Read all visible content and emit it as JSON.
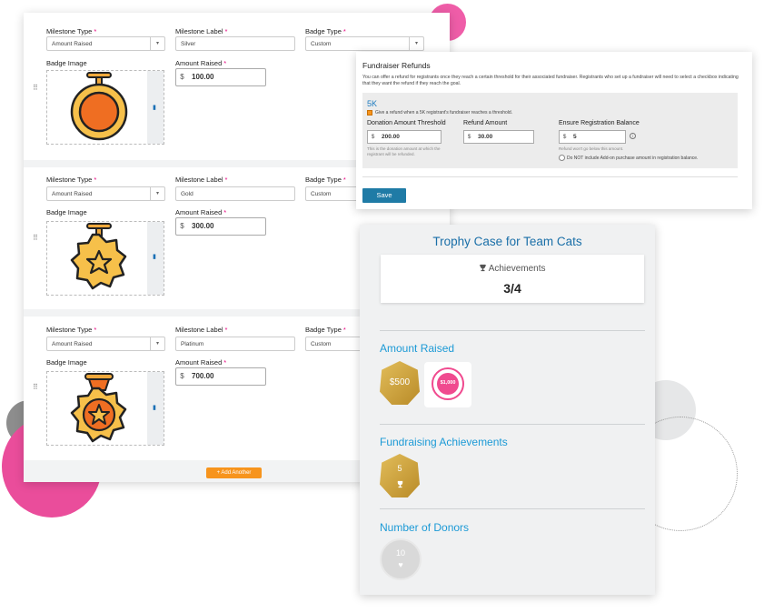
{
  "milestones": {
    "labels": {
      "milestone_type": "Milestone Type",
      "milestone_label": "Milestone Label",
      "badge_type": "Badge Type",
      "badge_image": "Badge Image",
      "amount_raised": "Amount Raised",
      "required": "*"
    },
    "currency_symbol": "$",
    "select_caret": "▾",
    "cards": [
      {
        "type_value": "Amount Raised",
        "label_value": "Silver",
        "badge_type_value": "Custom",
        "amount": "100.00",
        "badge_icon": "medal-ring-icon"
      },
      {
        "type_value": "Amount Raised",
        "label_value": "Gold",
        "badge_type_value": "Custom",
        "amount": "300.00",
        "badge_icon": "gear-star-medal-icon"
      },
      {
        "type_value": "Amount Raised",
        "label_value": "Platinum",
        "badge_type_value": "Custom",
        "amount": "700.00",
        "badge_icon": "ribbon-star-medal-icon"
      }
    ],
    "add_button": "+ Add Another"
  },
  "refunds": {
    "title": "Fundraiser Refunds",
    "description": "You can offer a refund for registrants once they reach a certain threshold for their associated fundraiser. Registrants who set up a fundraiser will need to select a checkbox indicating that they want the refund if they reach the goal.",
    "event_name": "5K",
    "checkbox_label": "Give a refund when a 5K registrant's fundraiser reaches a threshold.",
    "donation_threshold_label": "Donation Amount Threshold",
    "donation_threshold_value": "200.00",
    "donation_threshold_help": "This is the donation amount at which the registrant will be refunded.",
    "refund_amount_label": "Refund Amount",
    "refund_amount_value": "30.00",
    "balance_label": "Ensure Registration Balance",
    "balance_value": "5",
    "balance_help": "Refund won't go below this amount.",
    "addon_option": "Do NOT include Add-on purchase amount in registration balance.",
    "save_label": "Save"
  },
  "trophy": {
    "title": "Trophy Case for Team Cats",
    "achievements_label": "Achievements",
    "achievements_count": "3/4",
    "sections": [
      {
        "title": "Amount Raised",
        "badges": [
          "$500",
          "$1,000"
        ]
      },
      {
        "title": "Fundraising Achievements",
        "badges": [
          "5"
        ]
      },
      {
        "title": "Number of Donors",
        "badges": [
          "10"
        ]
      }
    ]
  },
  "colors": {
    "accent_blue": "#1c9ad6",
    "title_blue": "#1a6fa8",
    "pink": "#e6007e",
    "orange": "#f7941d",
    "gold": "#c9a13b"
  }
}
